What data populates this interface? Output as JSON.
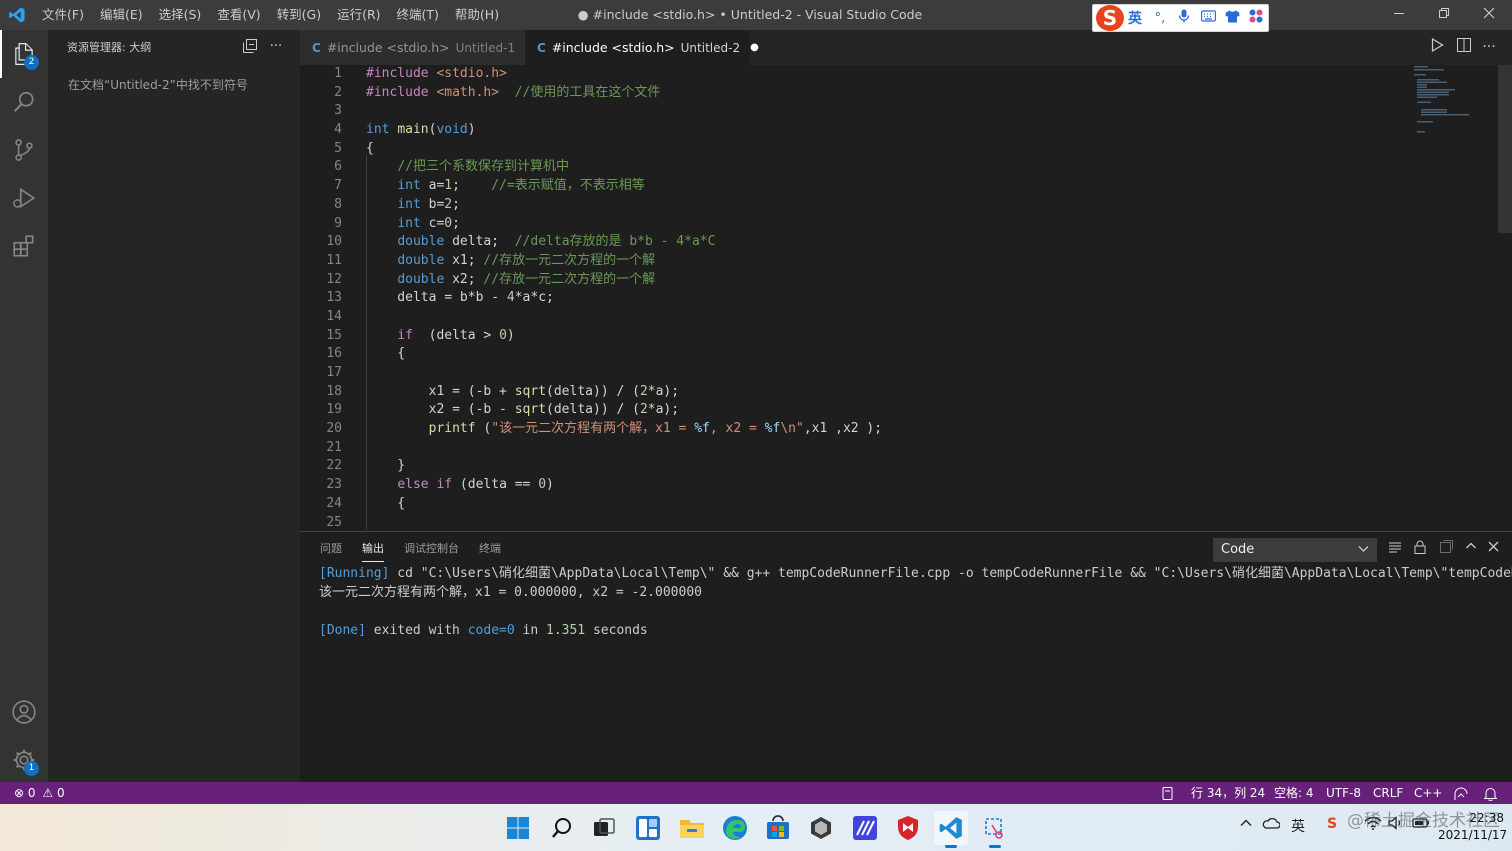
{
  "window": {
    "title": "● #include <stdio.h> • Untitled-2 - Visual Studio Code",
    "menu": [
      "文件(F)",
      "编辑(E)",
      "选择(S)",
      "查看(V)",
      "转到(G)",
      "运行(R)",
      "终端(T)",
      "帮助(H)"
    ]
  },
  "ime": {
    "brand": "S",
    "lang": "英",
    "icons": [
      "punct-icon",
      "mic-icon",
      "keyboard-icon",
      "skin-icon",
      "apps-icon"
    ]
  },
  "activity": {
    "explorer_badge": "2",
    "settings_badge": "1"
  },
  "sidebar": {
    "header": "资源管理器: 大纲",
    "message": "在文档“Untitled-2”中找不到符号"
  },
  "tabs": [
    {
      "label": "#include <stdio.h>",
      "sub": "Untitled-1",
      "active": false
    },
    {
      "label": "#include <stdio.h>",
      "sub": "Untitled-2",
      "active": true
    }
  ],
  "editor": {
    "line_numbers": [
      "1",
      "2",
      "3",
      "4",
      "5",
      "6",
      "7",
      "8",
      "9",
      "10",
      "11",
      "12",
      "13",
      "14",
      "15",
      "16",
      "17",
      "18",
      "19",
      "20",
      "21",
      "22",
      "23",
      "24",
      "25"
    ],
    "lines": [
      [
        [
          "pp",
          "#include "
        ],
        [
          "hd",
          "<stdio.h>"
        ]
      ],
      [
        [
          "pp",
          "#include "
        ],
        [
          "hd",
          "<math.h>"
        ],
        [
          "",
          "  "
        ],
        [
          "cm",
          "//使用的工具在这个文件"
        ]
      ],
      [],
      [
        [
          "kw",
          "int"
        ],
        [
          "",
          " "
        ],
        [
          "fn",
          "main"
        ],
        [
          "",
          "("
        ],
        [
          "kw",
          "void"
        ],
        [
          "",
          ")"
        ]
      ],
      [
        [
          "",
          "{"
        ]
      ],
      [
        [
          "",
          "    "
        ],
        [
          "cm",
          "//把三个系数保存到计算机中"
        ]
      ],
      [
        [
          "",
          "    "
        ],
        [
          "kw",
          "int"
        ],
        [
          "",
          " a="
        ],
        [
          "nm",
          "1"
        ],
        [
          "",
          ";    "
        ],
        [
          "cm",
          "//=表示赋值，不表示相等"
        ]
      ],
      [
        [
          "",
          "    "
        ],
        [
          "kw",
          "int"
        ],
        [
          "",
          " b="
        ],
        [
          "nm",
          "2"
        ],
        [
          "",
          ";"
        ]
      ],
      [
        [
          "",
          "    "
        ],
        [
          "kw",
          "int"
        ],
        [
          "",
          " c="
        ],
        [
          "nm",
          "0"
        ],
        [
          "",
          ";"
        ]
      ],
      [
        [
          "",
          "    "
        ],
        [
          "kw",
          "double"
        ],
        [
          "",
          " delta;  "
        ],
        [
          "cm",
          "//delta存放的是 b*b - 4*a*C"
        ]
      ],
      [
        [
          "",
          "    "
        ],
        [
          "kw",
          "double"
        ],
        [
          "",
          " x1; "
        ],
        [
          "cm",
          "//存放一元二次方程的一个解"
        ]
      ],
      [
        [
          "",
          "    "
        ],
        [
          "kw",
          "double"
        ],
        [
          "",
          " x2; "
        ],
        [
          "cm",
          "//存放一元二次方程的一个解"
        ]
      ],
      [
        [
          "",
          "    delta = b*b - "
        ],
        [
          "nm",
          "4"
        ],
        [
          "",
          "*a*c;"
        ]
      ],
      [],
      [
        [
          "",
          "    "
        ],
        [
          "pp",
          "if"
        ],
        [
          "",
          "  (delta > "
        ],
        [
          "nm",
          "0"
        ],
        [
          "",
          ")"
        ]
      ],
      [
        [
          "",
          "    {"
        ]
      ],
      [],
      [
        [
          "",
          "        x1 = (-b + "
        ],
        [
          "fn",
          "sqrt"
        ],
        [
          "",
          "(delta)) / ("
        ],
        [
          "nm",
          "2"
        ],
        [
          "",
          "*a);"
        ]
      ],
      [
        [
          "",
          "        x2 = (-b - "
        ],
        [
          "fn",
          "sqrt"
        ],
        [
          "",
          "(delta)) / ("
        ],
        [
          "nm",
          "2"
        ],
        [
          "",
          "*a);"
        ]
      ],
      [
        [
          "",
          "        "
        ],
        [
          "fn",
          "printf"
        ],
        [
          "",
          " ("
        ],
        [
          "st",
          "\"该一元二次方程有两个解，x1 = "
        ],
        [
          "fmt",
          "%f"
        ],
        [
          "st",
          ", x2 = "
        ],
        [
          "fmt",
          "%f"
        ],
        [
          "st",
          "\\n\""
        ],
        [
          "",
          ",x1 ,x2 );"
        ]
      ],
      [],
      [
        [
          "",
          "    }"
        ]
      ],
      [
        [
          "",
          "    "
        ],
        [
          "pp",
          "else"
        ],
        [
          "",
          " "
        ],
        [
          "pp",
          "if"
        ],
        [
          "",
          " (delta == "
        ],
        [
          "nm",
          "0"
        ],
        [
          "",
          ")"
        ]
      ],
      [
        [
          "",
          "    {"
        ]
      ],
      []
    ]
  },
  "panel": {
    "tabs": [
      "问题",
      "输出",
      "调试控制台",
      "终端"
    ],
    "active_tab": 1,
    "output_channel": "Code",
    "output": {
      "run_tag": "[Running]",
      "run_cmd": " cd \"C:\\Users\\硝化细菌\\AppData\\Local\\Temp\\\" && g++ tempCodeRunnerFile.cpp -o tempCodeRunnerFile && \"C:\\Users\\硝化细菌\\AppData\\Local\\Temp\\\"tempCodeRunnerFile",
      "result": "该一元二次方程有两个解，x1 = 0.000000, x2 = -2.000000",
      "done_tag": "[Done]",
      "done_a": " exited with ",
      "done_code": "code=0",
      "done_b": " in ",
      "done_time": "1.351",
      "done_c": " seconds"
    }
  },
  "status": {
    "errors": "0",
    "warnings": "0",
    "position": "行 34，列 24",
    "spaces": "空格: 4",
    "encoding": "UTF-8",
    "eol": "CRLF",
    "language": "C++"
  },
  "taskbar": {
    "tray_lang": "英",
    "time": "22:38",
    "date": "2021/11/17",
    "watermark": "@稀土掘金技术社区"
  },
  "colors": {
    "statusbar": "#68217a",
    "accent": "#0e70c0",
    "titlebar": "#3c3c3c"
  }
}
